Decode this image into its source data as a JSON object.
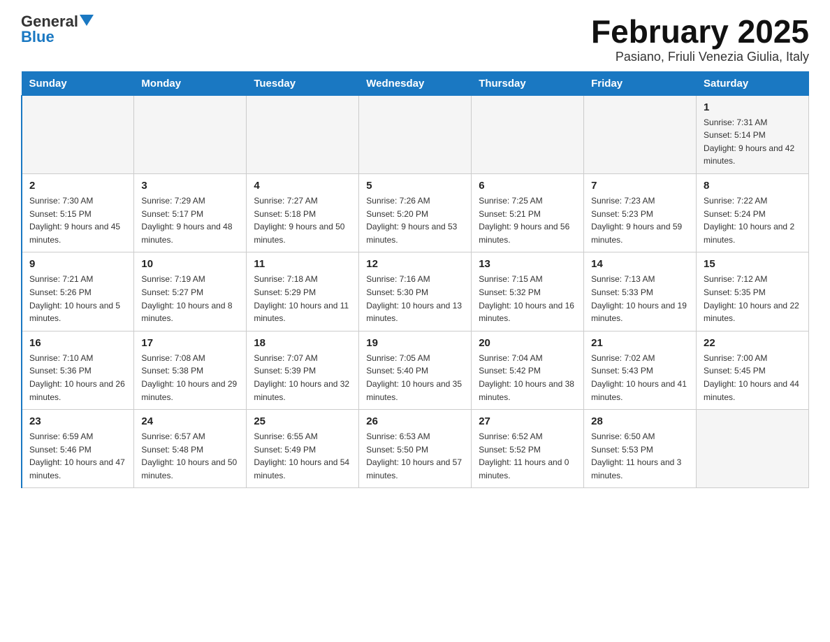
{
  "logo": {
    "text_general": "General",
    "text_blue": "Blue"
  },
  "header": {
    "month_year": "February 2025",
    "location": "Pasiano, Friuli Venezia Giulia, Italy"
  },
  "days_of_week": [
    "Sunday",
    "Monday",
    "Tuesday",
    "Wednesday",
    "Thursday",
    "Friday",
    "Saturday"
  ],
  "weeks": [
    {
      "days": [
        {
          "number": "",
          "sunrise": "",
          "sunset": "",
          "daylight": ""
        },
        {
          "number": "",
          "sunrise": "",
          "sunset": "",
          "daylight": ""
        },
        {
          "number": "",
          "sunrise": "",
          "sunset": "",
          "daylight": ""
        },
        {
          "number": "",
          "sunrise": "",
          "sunset": "",
          "daylight": ""
        },
        {
          "number": "",
          "sunrise": "",
          "sunset": "",
          "daylight": ""
        },
        {
          "number": "",
          "sunrise": "",
          "sunset": "",
          "daylight": ""
        },
        {
          "number": "1",
          "sunrise": "Sunrise: 7:31 AM",
          "sunset": "Sunset: 5:14 PM",
          "daylight": "Daylight: 9 hours and 42 minutes."
        }
      ]
    },
    {
      "days": [
        {
          "number": "2",
          "sunrise": "Sunrise: 7:30 AM",
          "sunset": "Sunset: 5:15 PM",
          "daylight": "Daylight: 9 hours and 45 minutes."
        },
        {
          "number": "3",
          "sunrise": "Sunrise: 7:29 AM",
          "sunset": "Sunset: 5:17 PM",
          "daylight": "Daylight: 9 hours and 48 minutes."
        },
        {
          "number": "4",
          "sunrise": "Sunrise: 7:27 AM",
          "sunset": "Sunset: 5:18 PM",
          "daylight": "Daylight: 9 hours and 50 minutes."
        },
        {
          "number": "5",
          "sunrise": "Sunrise: 7:26 AM",
          "sunset": "Sunset: 5:20 PM",
          "daylight": "Daylight: 9 hours and 53 minutes."
        },
        {
          "number": "6",
          "sunrise": "Sunrise: 7:25 AM",
          "sunset": "Sunset: 5:21 PM",
          "daylight": "Daylight: 9 hours and 56 minutes."
        },
        {
          "number": "7",
          "sunrise": "Sunrise: 7:23 AM",
          "sunset": "Sunset: 5:23 PM",
          "daylight": "Daylight: 9 hours and 59 minutes."
        },
        {
          "number": "8",
          "sunrise": "Sunrise: 7:22 AM",
          "sunset": "Sunset: 5:24 PM",
          "daylight": "Daylight: 10 hours and 2 minutes."
        }
      ]
    },
    {
      "days": [
        {
          "number": "9",
          "sunrise": "Sunrise: 7:21 AM",
          "sunset": "Sunset: 5:26 PM",
          "daylight": "Daylight: 10 hours and 5 minutes."
        },
        {
          "number": "10",
          "sunrise": "Sunrise: 7:19 AM",
          "sunset": "Sunset: 5:27 PM",
          "daylight": "Daylight: 10 hours and 8 minutes."
        },
        {
          "number": "11",
          "sunrise": "Sunrise: 7:18 AM",
          "sunset": "Sunset: 5:29 PM",
          "daylight": "Daylight: 10 hours and 11 minutes."
        },
        {
          "number": "12",
          "sunrise": "Sunrise: 7:16 AM",
          "sunset": "Sunset: 5:30 PM",
          "daylight": "Daylight: 10 hours and 13 minutes."
        },
        {
          "number": "13",
          "sunrise": "Sunrise: 7:15 AM",
          "sunset": "Sunset: 5:32 PM",
          "daylight": "Daylight: 10 hours and 16 minutes."
        },
        {
          "number": "14",
          "sunrise": "Sunrise: 7:13 AM",
          "sunset": "Sunset: 5:33 PM",
          "daylight": "Daylight: 10 hours and 19 minutes."
        },
        {
          "number": "15",
          "sunrise": "Sunrise: 7:12 AM",
          "sunset": "Sunset: 5:35 PM",
          "daylight": "Daylight: 10 hours and 22 minutes."
        }
      ]
    },
    {
      "days": [
        {
          "number": "16",
          "sunrise": "Sunrise: 7:10 AM",
          "sunset": "Sunset: 5:36 PM",
          "daylight": "Daylight: 10 hours and 26 minutes."
        },
        {
          "number": "17",
          "sunrise": "Sunrise: 7:08 AM",
          "sunset": "Sunset: 5:38 PM",
          "daylight": "Daylight: 10 hours and 29 minutes."
        },
        {
          "number": "18",
          "sunrise": "Sunrise: 7:07 AM",
          "sunset": "Sunset: 5:39 PM",
          "daylight": "Daylight: 10 hours and 32 minutes."
        },
        {
          "number": "19",
          "sunrise": "Sunrise: 7:05 AM",
          "sunset": "Sunset: 5:40 PM",
          "daylight": "Daylight: 10 hours and 35 minutes."
        },
        {
          "number": "20",
          "sunrise": "Sunrise: 7:04 AM",
          "sunset": "Sunset: 5:42 PM",
          "daylight": "Daylight: 10 hours and 38 minutes."
        },
        {
          "number": "21",
          "sunrise": "Sunrise: 7:02 AM",
          "sunset": "Sunset: 5:43 PM",
          "daylight": "Daylight: 10 hours and 41 minutes."
        },
        {
          "number": "22",
          "sunrise": "Sunrise: 7:00 AM",
          "sunset": "Sunset: 5:45 PM",
          "daylight": "Daylight: 10 hours and 44 minutes."
        }
      ]
    },
    {
      "days": [
        {
          "number": "23",
          "sunrise": "Sunrise: 6:59 AM",
          "sunset": "Sunset: 5:46 PM",
          "daylight": "Daylight: 10 hours and 47 minutes."
        },
        {
          "number": "24",
          "sunrise": "Sunrise: 6:57 AM",
          "sunset": "Sunset: 5:48 PM",
          "daylight": "Daylight: 10 hours and 50 minutes."
        },
        {
          "number": "25",
          "sunrise": "Sunrise: 6:55 AM",
          "sunset": "Sunset: 5:49 PM",
          "daylight": "Daylight: 10 hours and 54 minutes."
        },
        {
          "number": "26",
          "sunrise": "Sunrise: 6:53 AM",
          "sunset": "Sunset: 5:50 PM",
          "daylight": "Daylight: 10 hours and 57 minutes."
        },
        {
          "number": "27",
          "sunrise": "Sunrise: 6:52 AM",
          "sunset": "Sunset: 5:52 PM",
          "daylight": "Daylight: 11 hours and 0 minutes."
        },
        {
          "number": "28",
          "sunrise": "Sunrise: 6:50 AM",
          "sunset": "Sunset: 5:53 PM",
          "daylight": "Daylight: 11 hours and 3 minutes."
        },
        {
          "number": "",
          "sunrise": "",
          "sunset": "",
          "daylight": ""
        }
      ]
    }
  ]
}
